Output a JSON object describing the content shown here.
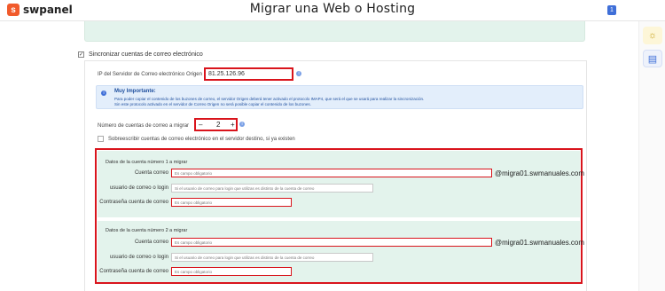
{
  "header": {
    "brand": "swpanel",
    "brand_icon": "s",
    "title": "Migrar una Web o Hosting",
    "badge": "1"
  },
  "rail": {
    "sun_icon": "☼",
    "doc_icon": "▤"
  },
  "sync": {
    "checkbox_mark": "✓",
    "label": "Sincronizar cuentas de correo electrónico"
  },
  "ip": {
    "label": "IP del Servidor de Correo electrónico Origen",
    "value": "81.25.126.96"
  },
  "important": {
    "title": "Muy Importante:",
    "line1": "Para poder copiar el contenido de los buzones de correo, el servidor Origen deberá tener activado el protocolo IMAP4, que será el que se usará para realizar la sincronización.",
    "line2": "Sin este protocolo activado en el servidor de Correo Origen no será posible copiar el contenido de los buzones."
  },
  "count": {
    "label": "Número de cuentas de correo a migrar",
    "minus": "–",
    "value": "2",
    "plus": "+"
  },
  "overwrite": {
    "label": "Sobreescribir cuentas de correo electrónico en el servidor destino, si ya existen"
  },
  "accounts": [
    {
      "title": "Datos de la cuenta número 1 a migrar",
      "email_label": "Cuenta correo",
      "email_placeholder": "Es campo obligatorio",
      "domain": "@migra01.swmanuales.com",
      "user_label": "usuario de correo o login",
      "user_placeholder": "Si el usuario de correo para login que utilizas es distinto de la cuenta de correo",
      "pass_label": "Contraseña cuenta de correo",
      "pass_placeholder": "Es campo obligatorio"
    },
    {
      "title": "Datos de la cuenta número 2 a migrar",
      "email_label": "Cuenta correo",
      "email_placeholder": "Es campo obligatorio",
      "domain": "@migra01.swmanuales.com",
      "user_label": "usuario de correo o login",
      "user_placeholder": "Si el usuario de correo para login que utilizas es distinto de la cuenta de correo",
      "pass_label": "Contraseña cuenta de correo",
      "pass_placeholder": "Es campo obligatorio"
    }
  ],
  "info_icon": "i"
}
